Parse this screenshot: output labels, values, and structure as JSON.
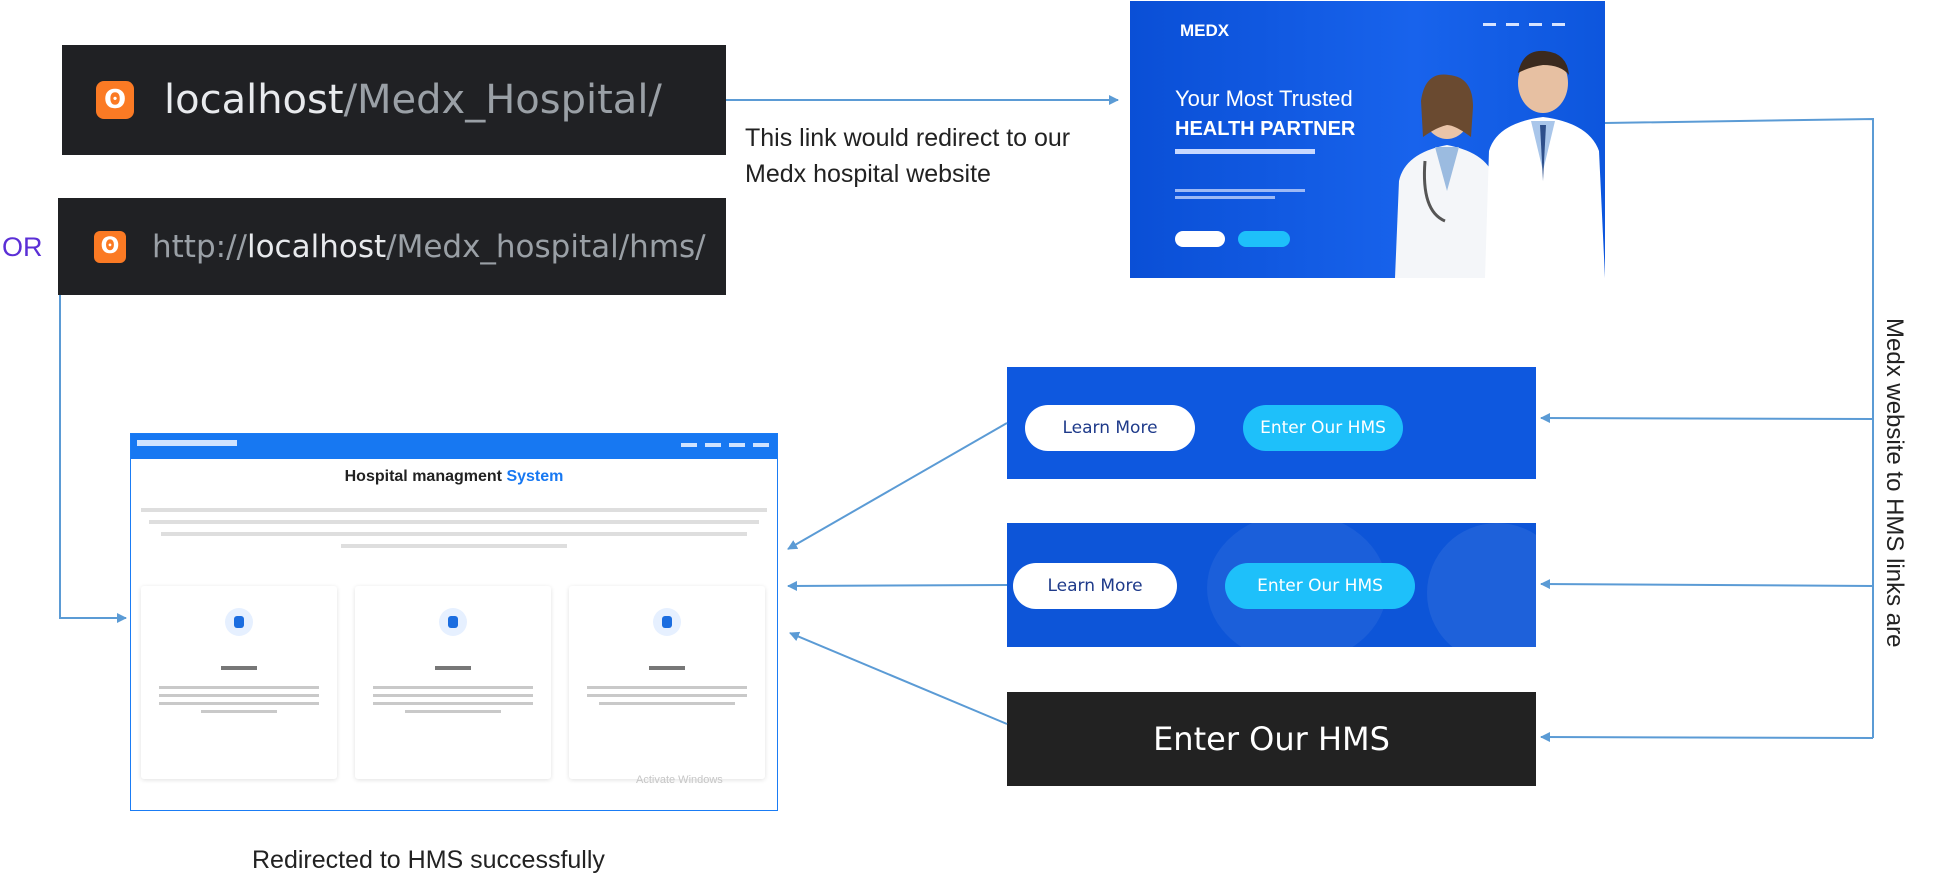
{
  "url_bar_1": {
    "host": "localhost",
    "path": "/Medx_Hospital/"
  },
  "or_label": "OR",
  "url_bar_2": {
    "scheme": "http://",
    "host": "localhost",
    "path": "/Medx_hospital/hms/"
  },
  "redirect_note_line1": "This link would redirect to our",
  "redirect_note_line2": "Medx hospital website",
  "medx_hero": {
    "logo": "MEDX",
    "headline_line1": "Your Most Trusted",
    "headline_line2": "HEALTH PARTNER"
  },
  "hms_page": {
    "title_part1": "Hospital managment ",
    "title_part2": "System",
    "watermark": "Activate Windows"
  },
  "panel1": {
    "learn_more": "Learn More",
    "enter_hms": "Enter Our HMS"
  },
  "panel2": {
    "learn_more": "Learn More",
    "enter_hms": "Enter Our HMS"
  },
  "panel3": {
    "enter_hms": "Enter Our HMS"
  },
  "side_label": "Medx website to HMS links are",
  "bottom_caption": "Redirected to HMS successfully",
  "colors": {
    "arrow": "#5b9bd5",
    "hms_blue": "#1778f2",
    "medx_blue": "#0e58df",
    "hms_button": "#1ec0fa",
    "or_label": "#5b2fd6"
  }
}
